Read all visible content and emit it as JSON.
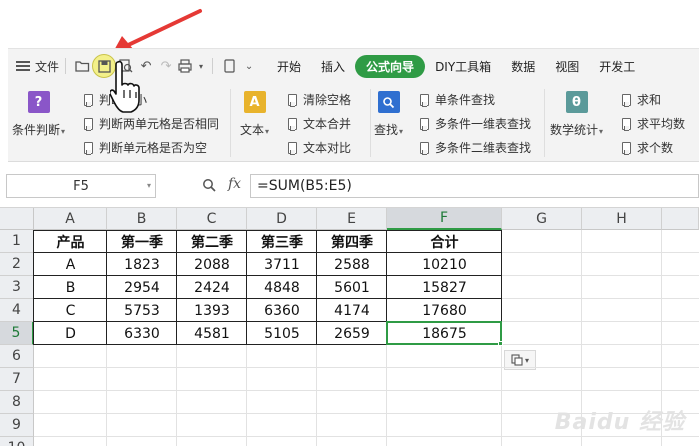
{
  "menu": {
    "file_label": "文件",
    "tabs": [
      {
        "label": "开始"
      },
      {
        "label": "插入"
      },
      {
        "label": "公式向导",
        "active": true
      },
      {
        "label": "DIY工具箱"
      },
      {
        "label": "数据"
      },
      {
        "label": "视图"
      },
      {
        "label": "开发工"
      }
    ]
  },
  "ribbon": {
    "condition_judge": "条件判断",
    "text": "文本",
    "lookup": "查找",
    "math_stats": "数学统计",
    "judge_items": [
      "判断大小",
      "判断两单元格是否相同",
      "判断单元格是否为空"
    ],
    "text_items": [
      "清除空格",
      "文本合并",
      "文本对比"
    ],
    "lookup_items": [
      "单条件查找",
      "多条件一维表查找",
      "多条件二维表查找"
    ],
    "math_items": [
      "求和",
      "求平均数",
      "求个数"
    ]
  },
  "formula_bar": {
    "cell_ref": "F5",
    "fx_label": "fx",
    "formula": "=SUM(B5:E5)"
  },
  "sheet": {
    "columns": [
      "A",
      "B",
      "C",
      "D",
      "E",
      "F",
      "G",
      "H"
    ],
    "rows": [
      "1",
      "2",
      "3",
      "4",
      "5",
      "6",
      "7",
      "8",
      "9",
      "10"
    ],
    "table": {
      "headers": [
        "产品",
        "第一季",
        "第二季",
        "第三季",
        "第四季",
        "合计"
      ],
      "data": [
        [
          "A",
          "1823",
          "2088",
          "3711",
          "2588",
          "10210"
        ],
        [
          "B",
          "2954",
          "2424",
          "4848",
          "5601",
          "15827"
        ],
        [
          "C",
          "5753",
          "1393",
          "6360",
          "4174",
          "17680"
        ],
        [
          "D",
          "6330",
          "4581",
          "5105",
          "2659",
          "18675"
        ]
      ]
    },
    "selected_cell": "F5"
  },
  "watermark": "Baidu 经验",
  "colors": {
    "accent_green": "#2f9b45",
    "arrow_red": "#e53935",
    "save_highlight": "#f3f08a"
  }
}
